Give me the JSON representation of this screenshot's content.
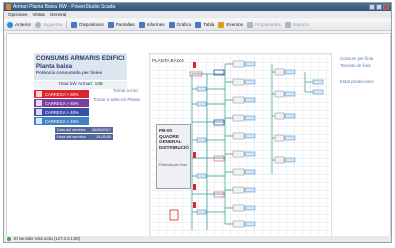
{
  "window": {
    "title": "Armari Planta Baixa RW - PowerStudio Scada"
  },
  "menu": {
    "items": [
      "Opciones",
      "Vistas",
      "General"
    ]
  },
  "toolbar": {
    "buttons": [
      {
        "label": "Anterior",
        "icon": "back-arrow-icon",
        "color": "#2e8bd6",
        "enabled": true
      },
      {
        "label": "Siguiente",
        "icon": "forward-arrow-icon",
        "color": "#b0b6bd",
        "enabled": false
      },
      {
        "label": "Dispositivos",
        "icon": "devices-icon",
        "color": "#4a78c0",
        "enabled": true
      },
      {
        "label": "Pantallas",
        "icon": "screens-icon",
        "color": "#4a78c0",
        "enabled": true
      },
      {
        "label": "Informes",
        "icon": "reports-icon",
        "color": "#4a78c0",
        "enabled": true
      },
      {
        "label": "Gráfico",
        "icon": "chart-icon",
        "color": "#4a78c0",
        "enabled": true
      },
      {
        "label": "Tabla",
        "icon": "table-icon",
        "color": "#4a78c0",
        "enabled": true
      },
      {
        "label": "Eventos",
        "icon": "events-icon",
        "color": "#d9a020",
        "enabled": true
      },
      {
        "label": "Propiedades",
        "icon": "properties-icon",
        "color": "#b0b6bd",
        "enabled": false
      },
      {
        "label": "Imprimir",
        "icon": "print-icon",
        "color": "#b0b6bd",
        "enabled": false
      }
    ]
  },
  "header": {
    "title": "CONSUMS ARMARIS EDIFICI",
    "subtitle": "Planta baixa",
    "caption": "Potència consumida per línies"
  },
  "total": {
    "label": "Total kW Armari:",
    "value": "136"
  },
  "legend": [
    {
      "label": "CARREGA > 80%",
      "color": "#d8262c"
    },
    {
      "label": "CARREGA > 60%",
      "color": "#7a3fa0"
    },
    {
      "label": "CARREGA > 40%",
      "color": "#3a4fa6"
    },
    {
      "label": "CARREGA < 40%",
      "color": "#3f83c6"
    }
  ],
  "links_left": {
    "back_to_level": "Tornar a inici",
    "back_to_plant": "Tornar a selecció Planta"
  },
  "info": [
    {
      "label": "Data del servidor",
      "value": "06/06/2017"
    },
    {
      "label": "Hora del servidor",
      "value": "14:20:00"
    }
  ],
  "diagram": {
    "plant_label": "PLANTA BAIXA",
    "panel_title": "PB-00 QUADRE GENERAL DISTRIBUCIÓ",
    "panel_footer": "Potència per línia"
  },
  "links_right": {
    "consumptions": "Consum per línia",
    "switch_off": "Tancats de línia",
    "protections": "Estat proteccions"
  },
  "status": {
    "text": "El servidor està actiu (127.0.0.1:80)"
  }
}
